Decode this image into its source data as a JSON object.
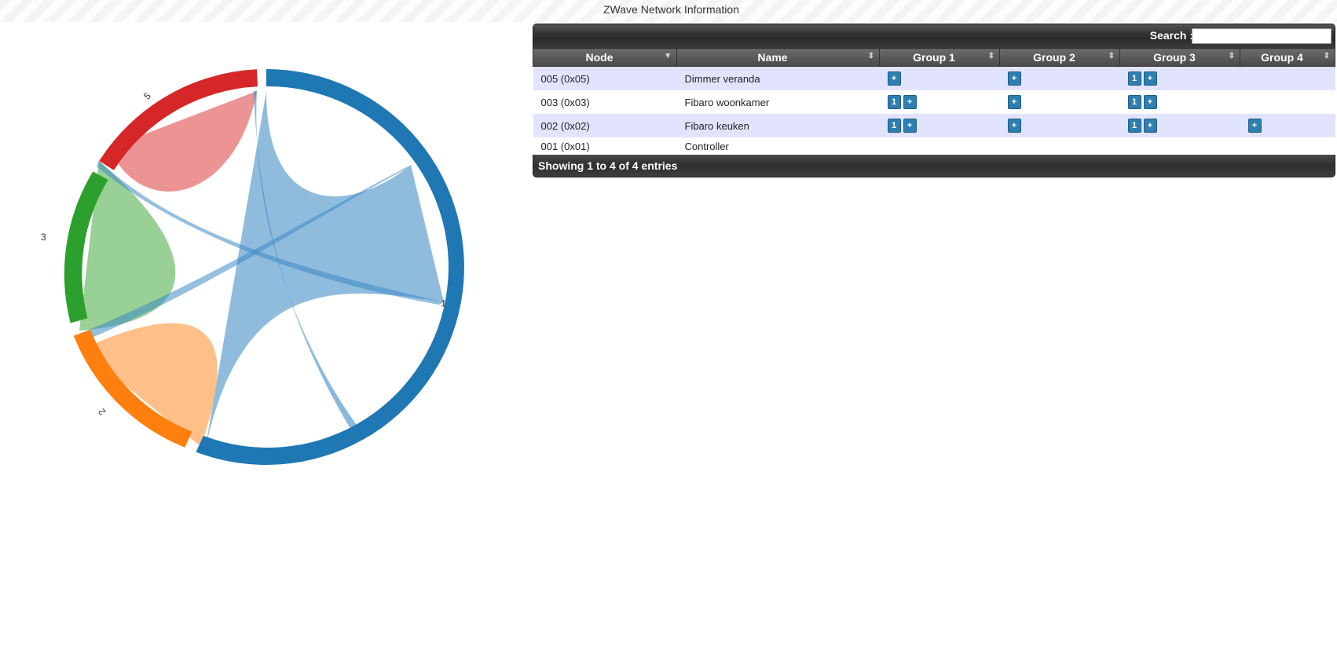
{
  "page_title": "ZWave Network Information",
  "colors": {
    "node_1": "#1f77b4",
    "node_2": "#ff7f0e",
    "node_3": "#2ca02c",
    "node_5": "#d62728"
  },
  "chord": {
    "labels": [
      "1",
      "2",
      "3",
      "5"
    ]
  },
  "table": {
    "search_label": "Search :",
    "search_value": "",
    "columns": [
      "Node",
      "Name",
      "Group 1",
      "Group 2",
      "Group 3",
      "Group 4"
    ],
    "rows": [
      {
        "node": "005 (0x05)",
        "name": "Dimmer veranda",
        "g1": [
          "+"
        ],
        "g2": [
          "+"
        ],
        "g3": [
          "1",
          "+"
        ],
        "g4": []
      },
      {
        "node": "003 (0x03)",
        "name": "Fibaro woonkamer",
        "g1": [
          "1",
          "+"
        ],
        "g2": [
          "+"
        ],
        "g3": [
          "1",
          "+"
        ],
        "g4": []
      },
      {
        "node": "002 (0x02)",
        "name": "Fibaro keuken",
        "g1": [
          "1",
          "+"
        ],
        "g2": [
          "+"
        ],
        "g3": [
          "1",
          "+"
        ],
        "g4": [
          "+"
        ]
      },
      {
        "node": "001 (0x01)",
        "name": "Controller",
        "g1": [],
        "g2": [],
        "g3": [],
        "g4": []
      }
    ],
    "info": "Showing 1 to 4 of 4 entries"
  }
}
